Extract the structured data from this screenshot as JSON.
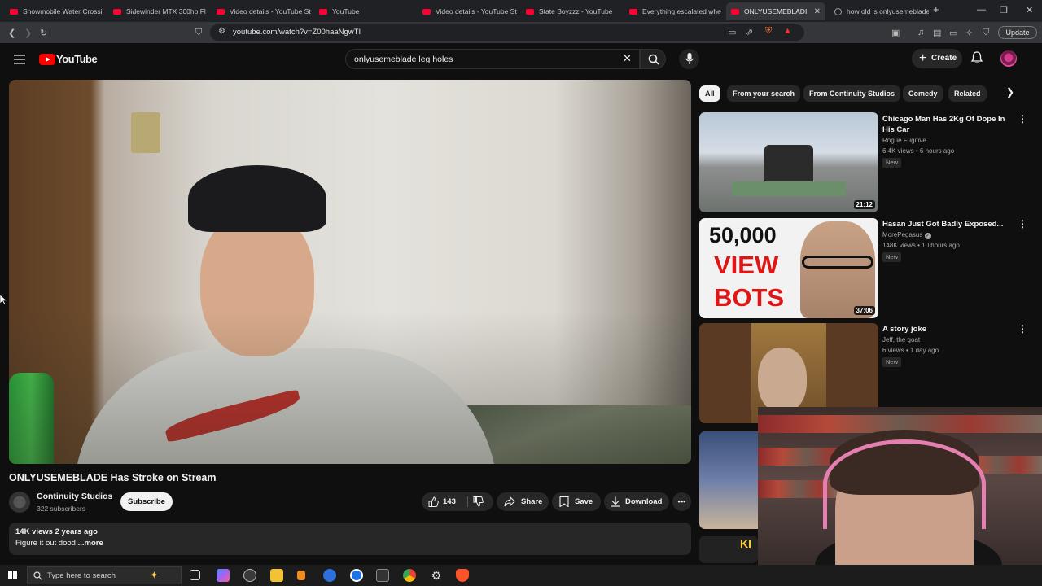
{
  "browser": {
    "tabs": [
      {
        "label": "Snowmobile Water Crossi",
        "favicon": "youtube"
      },
      {
        "label": "Sidewinder MTX 300hp Fl",
        "favicon": "youtube"
      },
      {
        "label": "Video details - YouTube St",
        "favicon": "youtube"
      },
      {
        "label": "YouTube",
        "favicon": "youtube"
      },
      {
        "label": "Video details - YouTube St",
        "favicon": "youtube"
      },
      {
        "label": "State Boyzzz - YouTube",
        "favicon": "youtube"
      },
      {
        "label": "Everything escalated whe",
        "favicon": "youtube"
      },
      {
        "label": "ONLYUSEMEBLADI",
        "favicon": "youtube",
        "active": true
      },
      {
        "label": "how old is onlyusemeblade",
        "favicon": "google"
      }
    ],
    "url": "youtube.com/watch?v=Z00haaNgwTI",
    "update_label": "Update"
  },
  "youtube": {
    "logo_text": "YouTube",
    "search_query": "onlyusemeblade leg holes",
    "create_label": "Create",
    "brand_color": "#ff0000"
  },
  "video": {
    "title": "ONLYUSEMEBLADE Has Stroke on Stream",
    "channel": "Continuity Studios",
    "subscribers": "322 subscribers",
    "subscribe_label": "Subscribe",
    "likes": "143",
    "share_label": "Share",
    "save_label": "Save",
    "download_label": "Download",
    "views_age": "14K views  2 years ago",
    "description": "Figure it out dood",
    "more_label": "...more"
  },
  "chips": [
    "All",
    "From your search",
    "From Continuity Studios",
    "Comedy",
    "Related"
  ],
  "recommended": [
    {
      "title": "Chicago Man Has 2Kg Of Dope In His Car",
      "channel": "Rogue Fugitive",
      "meta": "6.4K views • 6 hours ago",
      "badge": "New",
      "duration": "21:12"
    },
    {
      "title": "Hasan Just Got Badly Exposed...",
      "channel": "MorePegasus",
      "verified": true,
      "meta": "148K views • 10 hours ago",
      "badge": "New",
      "duration": "37:06",
      "thumb_text_1": "50,000",
      "thumb_text_2": "VIEW",
      "thumb_text_3": "BOTS"
    },
    {
      "title": "A story joke",
      "channel": "Jeff, the goat",
      "meta": "6 views • 1 day ago",
      "badge": "New"
    }
  ],
  "thumb_overlay_text": "KI",
  "taskbar": {
    "search_placeholder": "Type here to search"
  }
}
